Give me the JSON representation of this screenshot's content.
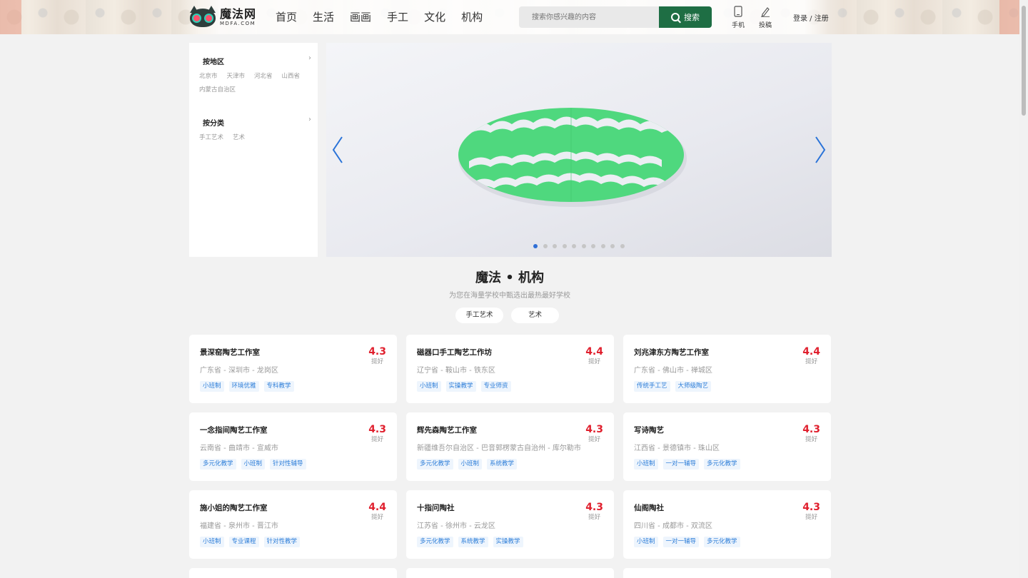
{
  "site": {
    "logo_text": "魔法网",
    "logo_sub": "MDFA.COM",
    "nav": [
      "首页",
      "生活",
      "画画",
      "手工",
      "文化",
      "机构"
    ],
    "search_placeholder": "搜索你感兴趣的内容",
    "search_button": "搜索",
    "phone_label": "手机",
    "post_label": "投稿",
    "login_label": "登录 / 注册",
    "accent_color": "#1e6e44"
  },
  "sidebar": {
    "region_title": "按地区",
    "regions": [
      "北京市",
      "天津市",
      "河北省",
      "山西省",
      "内蒙古自治区"
    ],
    "category_title": "按分类",
    "categories": [
      "手工艺术",
      "艺术"
    ]
  },
  "banner": {
    "slide_count": 10,
    "active_slide": 1,
    "image_subject": "green paper-cut watermelon slice"
  },
  "section": {
    "title": "魔法 • 机构",
    "subtitle": "为您在海量学校中甄选出最热最好学校",
    "filters": [
      "手工艺术",
      "艺术"
    ]
  },
  "cards": [
    {
      "name": "景深窑陶艺工作室",
      "location": "广东省 - 深圳市 - 龙岗区",
      "score": "4.3",
      "score_label": "挺好",
      "tags": [
        "小班制",
        "环境优雅",
        "专科教学"
      ]
    },
    {
      "name": "磁器口手工陶艺工作坊",
      "location": "辽宁省 - 鞍山市 - 铁东区",
      "score": "4.4",
      "score_label": "挺好",
      "tags": [
        "小班制",
        "实操教学",
        "专业师资"
      ]
    },
    {
      "name": "刘兆津东方陶艺工作室",
      "location": "广东省 - 佛山市 - 禅城区",
      "score": "4.4",
      "score_label": "挺好",
      "tags": [
        "传统手工艺",
        "大师级陶艺"
      ]
    },
    {
      "name": "一念指间陶艺工作室",
      "location": "云南省 - 曲靖市 - 宣威市",
      "score": "4.3",
      "score_label": "挺好",
      "tags": [
        "多元化教学",
        "小班制",
        "针对性辅导"
      ]
    },
    {
      "name": "辉先森陶艺工作室",
      "location": "新疆维吾尔自治区 - 巴音郭楞蒙古自治州 - 库尔勒市",
      "score": "4.3",
      "score_label": "挺好",
      "tags": [
        "多元化教学",
        "小班制",
        "系统教学"
      ]
    },
    {
      "name": "写诗陶艺",
      "location": "江西省 - 景德镇市 - 珠山区",
      "score": "4.3",
      "score_label": "挺好",
      "tags": [
        "小班制",
        "一对一辅导",
        "多元化教学"
      ]
    },
    {
      "name": "施小姐的陶艺工作室",
      "location": "福建省 - 泉州市 - 晋江市",
      "score": "4.4",
      "score_label": "挺好",
      "tags": [
        "小班制",
        "专业课程",
        "针对性教学"
      ]
    },
    {
      "name": "十指问陶社",
      "location": "江苏省 - 徐州市 - 云龙区",
      "score": "4.3",
      "score_label": "挺好",
      "tags": [
        "多元化教学",
        "系统教学",
        "实操教学"
      ]
    },
    {
      "name": "仙阁陶社",
      "location": "四川省 - 成都市 - 双流区",
      "score": "4.3",
      "score_label": "挺好",
      "tags": [
        "小班制",
        "一对一辅导",
        "多元化教学"
      ]
    }
  ]
}
